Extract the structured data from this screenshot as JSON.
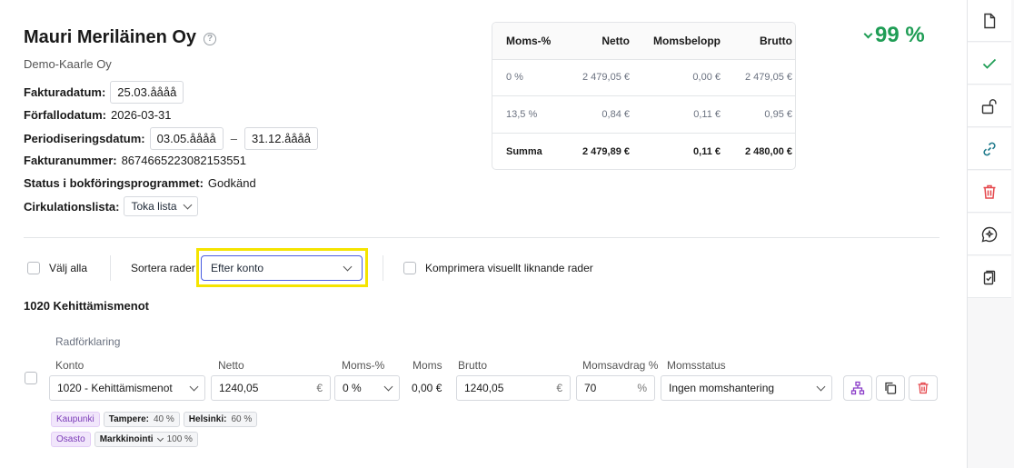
{
  "header": {
    "company": "Mauri Meriläinen Oy",
    "subtitle": "Demo-Kaarle Oy",
    "invoice_date_label": "Fakturadatum:",
    "invoice_date": "25.03.åååå",
    "due_date_label": "Förfallodatum:",
    "due_date": "2026-03-31",
    "period_label": "Periodiseringsdatum:",
    "period_start": "03.05.åååå",
    "period_sep": "–",
    "period_end": "31.12.åååå",
    "invoice_no_label": "Fakturanummer:",
    "invoice_no": "8674665223082153551",
    "status_label": "Status i bokföringsprogrammet:",
    "status": "Godkänd",
    "circ_label": "Cirkulationslista:",
    "circ_value": "Toka lista"
  },
  "vat_table": {
    "headers": [
      "Moms-%",
      "Netto",
      "Momsbelopp",
      "Brutto"
    ],
    "rows": [
      [
        "0 %",
        "2 479,05 €",
        "0,00 €",
        "2 479,05 €"
      ],
      [
        "13,5 %",
        "0,84 €",
        "0,11 €",
        "0,95 €"
      ]
    ],
    "sum": [
      "Summa",
      "2 479,89 €",
      "0,11 €",
      "2 480,00 €"
    ]
  },
  "confidence": "99 %",
  "controls": {
    "select_all": "Välj alla",
    "sort_label": "Sortera rader",
    "sort_value": "Efter konto",
    "compress_label": "Komprimera visuellt liknande rader"
  },
  "section": {
    "title": "1020 Kehittämismenot",
    "row_explain": "Radförklaring",
    "labels": {
      "konto": "Konto",
      "netto": "Netto",
      "moms_pct": "Moms-%",
      "moms": "Moms",
      "brutto": "Brutto",
      "deduction": "Momsavdrag %",
      "vat_status": "Momsstatus"
    },
    "line": {
      "konto": "1020 - Kehittämismenot",
      "netto": "1240,05",
      "currency": "€",
      "moms_pct": "0 %",
      "moms": "0,00 €",
      "brutto": "1240,05",
      "deduction": "70",
      "pct": "%",
      "vat_status": "Ingen momshantering"
    },
    "dimensions": [
      {
        "name": "Kaupunki",
        "items": [
          {
            "label": "Tampere:",
            "value": "40 %"
          },
          {
            "label": "Helsinki:",
            "value": "60 %"
          }
        ]
      },
      {
        "name": "Osasto",
        "items": [
          {
            "label": "Markkinointi",
            "value": "100 %"
          }
        ]
      }
    ]
  },
  "colors": {
    "accent": "#4a5ee0",
    "success": "#1f9d55",
    "danger": "#e5484d",
    "highlight": "#f5e400",
    "purple": "#8b3dc8",
    "teal": "#1f7a8c"
  }
}
